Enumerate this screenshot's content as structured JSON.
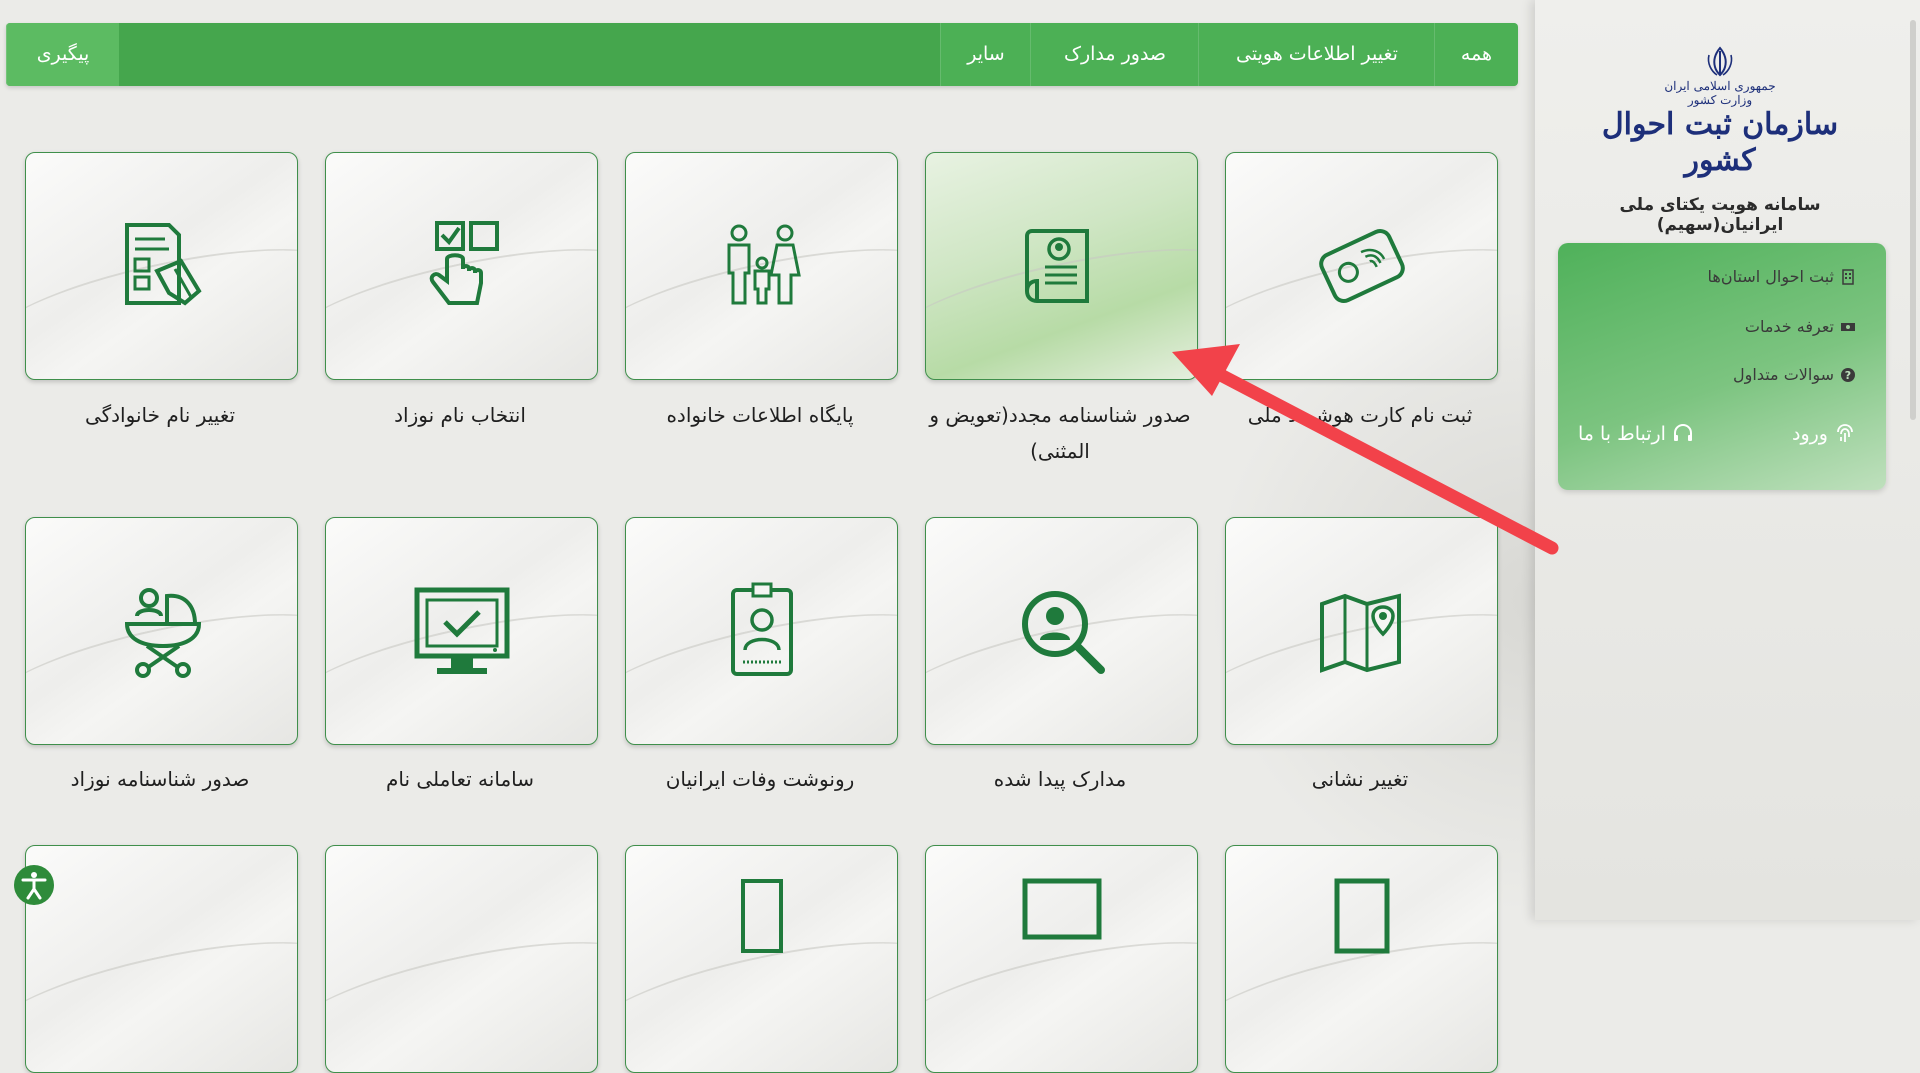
{
  "nav": {
    "items": [
      "همه",
      "تغییر اطلاعات هویتی",
      "صدور مدارک",
      "سایر"
    ],
    "follow_label": "پیگیری"
  },
  "sidebar": {
    "logo_sub_1": "جمهوری اسلامی ایران",
    "logo_sub_2": "وزارت کشور",
    "logo_main": "سازمان ثبت احوال کشور",
    "site_title": "سامانه هویت یکتای ملی ایرانیان(سهیم)",
    "links": [
      "ثبت احوال استان‌ها",
      "تعرفه خدمات",
      "سوالات متداول"
    ],
    "login_label": "ورود",
    "contact_label": "ارتباط با ما"
  },
  "tiles": [
    {
      "label": "ثبت نام کارت هوشمند ملی",
      "icon": "smart-card-fingerprint-icon"
    },
    {
      "label": "صدور شناسنامه مجدد(تعویض و المثنی)",
      "icon": "birth-certificate-scroll-icon"
    },
    {
      "label": "پایگاه اطلاعات خانواده",
      "icon": "family-icon"
    },
    {
      "label": "انتخاب نام نوزاد",
      "icon": "checkbox-hand-icon"
    },
    {
      "label": "تغییر نام خانوادگی",
      "icon": "form-edit-hand-icon"
    },
    {
      "label": "تغییر نشانی",
      "icon": "map-pin-icon"
    },
    {
      "label": "مدارک پیدا شده",
      "icon": "person-search-icon"
    },
    {
      "label": "رونوشت وفات ایرانیان",
      "icon": "id-badge-icon"
    },
    {
      "label": "سامانه تعاملی نام",
      "icon": "monitor-check-icon"
    },
    {
      "label": "صدور شناسنامه نوزاد",
      "icon": "baby-stroller-icon"
    }
  ],
  "colors": {
    "nav_green": "#45a64d",
    "icon_green": "#1f7a3c",
    "arrow_red": "#f2424a",
    "brand_blue": "#1d2f7a"
  }
}
